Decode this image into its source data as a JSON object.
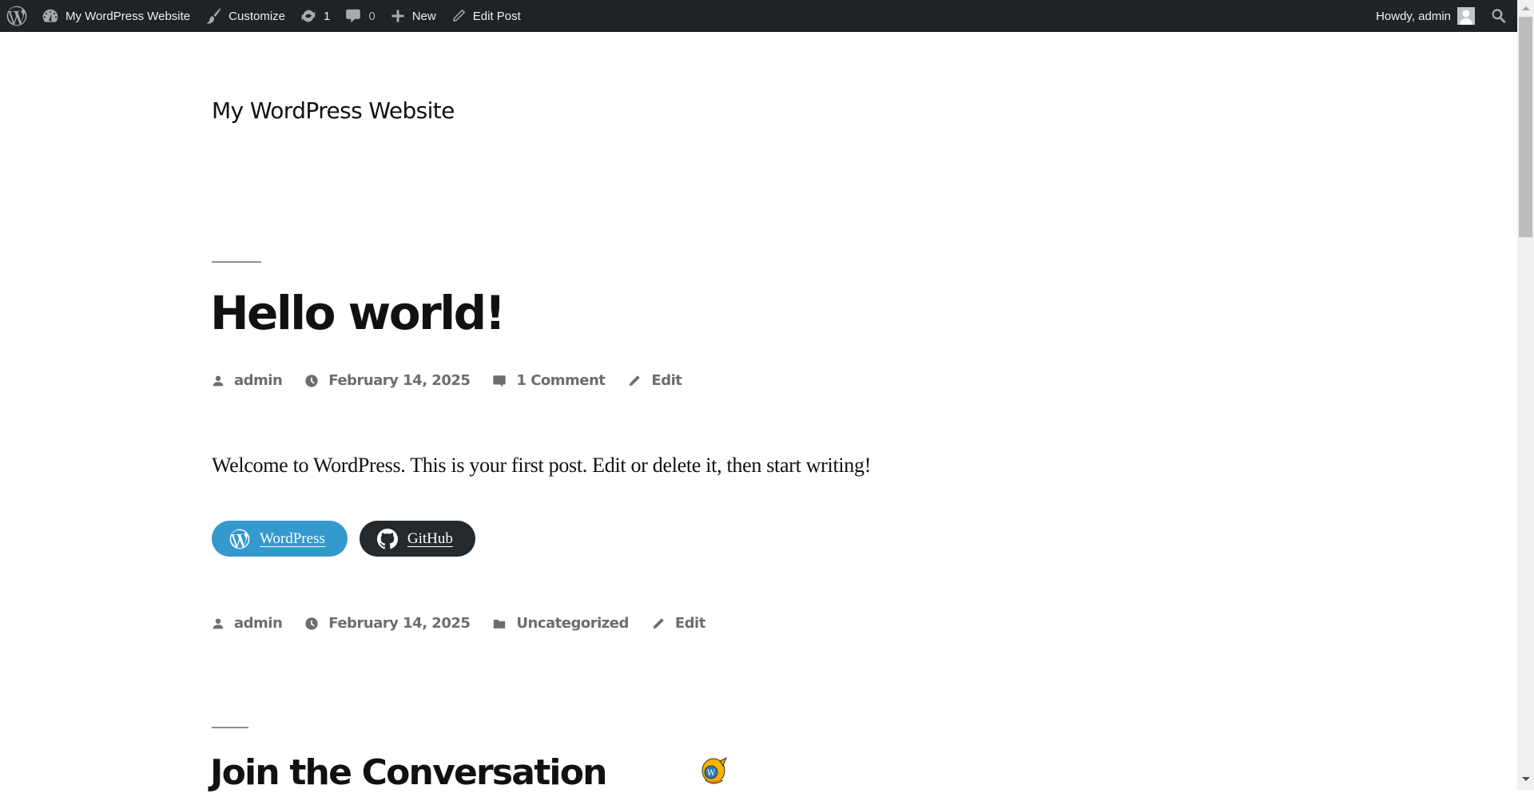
{
  "adminbar": {
    "wp_logo": "wordpress-logo-icon",
    "site_name": "My WordPress Website",
    "customize": "Customize",
    "updates_count": "1",
    "comments_count": "0",
    "new": "New",
    "edit_post": "Edit Post",
    "howdy": "Howdy, admin",
    "colors": {
      "background": "#1d2327",
      "text": "#f0f0f1",
      "icon": "#a7aaad"
    }
  },
  "site": {
    "title": "My WordPress Website"
  },
  "post": {
    "title": "Hello world!",
    "meta_top": {
      "author": "admin",
      "date": "February 14, 2025",
      "comments": "1 Comment",
      "edit": "Edit"
    },
    "content": "Welcome to WordPress. This is your first post. Edit or delete it, then start writing!",
    "social_links": [
      {
        "label": "WordPress",
        "icon": "wordpress-icon",
        "color": "#3499cd"
      },
      {
        "label": "GitHub",
        "icon": "github-icon",
        "color": "#24292d"
      }
    ],
    "meta_bottom": {
      "author": "admin",
      "date": "February 14, 2025",
      "category": "Uncategorized",
      "edit": "Edit"
    }
  },
  "comments": {
    "title": "Join the Conversation"
  }
}
